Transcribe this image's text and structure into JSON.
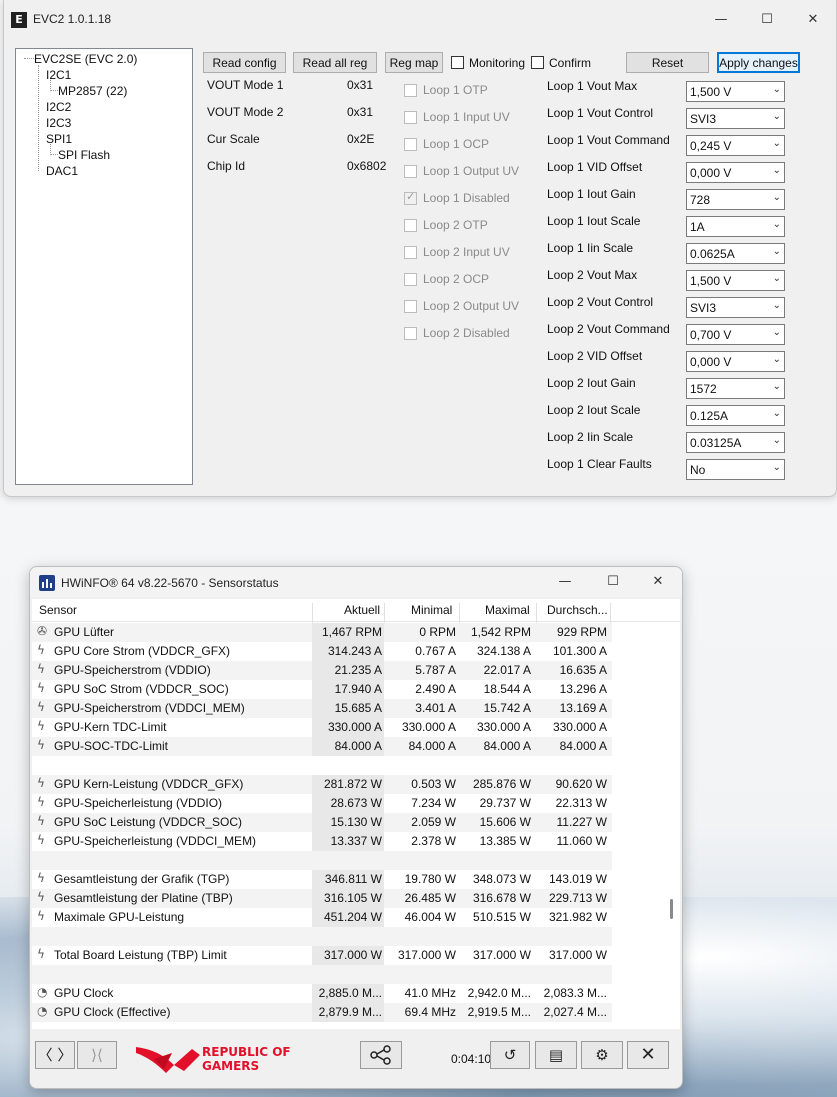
{
  "evc": {
    "title": "EVC2 1.0.1.18",
    "logo_text": "E",
    "controls": {
      "minimize": "—",
      "maximize": "☐",
      "close": "✕"
    },
    "tree": [
      {
        "label": "EVC2SE (EVC 2.0)"
      },
      {
        "label": "I2C1"
      },
      {
        "label": "MP2857 (22)"
      },
      {
        "label": "I2C2"
      },
      {
        "label": "I2C3"
      },
      {
        "label": "SPI1"
      },
      {
        "label": "SPI Flash"
      },
      {
        "label": "DAC1"
      }
    ],
    "buttons": {
      "read_config": "Read config",
      "read_all_reg": "Read all reg",
      "reg_map": "Reg map",
      "reset": "Reset",
      "apply": "Apply changes"
    },
    "toggles": {
      "monitoring": "Monitoring",
      "confirm": "Confirm"
    },
    "info": [
      {
        "label": "VOUT Mode 1",
        "value": "0x31"
      },
      {
        "label": "VOUT Mode 2",
        "value": "0x31"
      },
      {
        "label": "Cur Scale",
        "value": "0x2E"
      },
      {
        "label": "Chip Id",
        "value": "0x6802"
      }
    ],
    "flags": [
      {
        "label": "Loop 1 OTP",
        "checked": false
      },
      {
        "label": "Loop 1 Input UV",
        "checked": false
      },
      {
        "label": "Loop 1 OCP",
        "checked": false
      },
      {
        "label": "Loop 1 Output UV",
        "checked": false
      },
      {
        "label": "Loop 1 Disabled",
        "checked": true
      },
      {
        "label": "Loop 2 OTP",
        "checked": false
      },
      {
        "label": "Loop 2 Input UV",
        "checked": false
      },
      {
        "label": "Loop 2 OCP",
        "checked": false
      },
      {
        "label": "Loop 2 Output UV",
        "checked": false
      },
      {
        "label": "Loop 2 Disabled",
        "checked": false
      }
    ],
    "settings": [
      {
        "label": "Loop 1 Vout Max",
        "value": "1,500 V"
      },
      {
        "label": "Loop 1 Vout Control",
        "value": "SVI3"
      },
      {
        "label": "Loop 1 Vout Command",
        "value": "0,245 V"
      },
      {
        "label": "Loop 1 VID Offset",
        "value": "0,000 V"
      },
      {
        "label": "Loop 1 Iout Gain",
        "value": "728"
      },
      {
        "label": "Loop 1 Iout Scale",
        "value": "1A"
      },
      {
        "label": "Loop 1 Iin Scale",
        "value": "0.0625A"
      },
      {
        "label": "Loop 2 Vout Max",
        "value": "1,500 V"
      },
      {
        "label": "Loop 2 Vout Control",
        "value": "SVI3"
      },
      {
        "label": "Loop 2 Vout Command",
        "value": "0,700 V"
      },
      {
        "label": "Loop 2 VID Offset",
        "value": "0,000 V"
      },
      {
        "label": "Loop 2 Iout Gain",
        "value": "1572"
      },
      {
        "label": "Loop 2 Iout Scale",
        "value": "0.125A"
      },
      {
        "label": "Loop 2 Iin Scale",
        "value": "0.03125A"
      },
      {
        "label": "Loop 1 Clear Faults",
        "value": "No"
      }
    ]
  },
  "hw": {
    "title": "HWiNFO® 64 v8.22-5670 - Sensorstatus",
    "controls": {
      "minimize": "—",
      "maximize": "☐",
      "close": "✕"
    },
    "columns": [
      "Sensor",
      "Aktuell",
      "Minimal",
      "Maximal",
      "Durchsch..."
    ],
    "rows": [
      {
        "icon": "fan-icon",
        "name": "GPU Lüfter",
        "cur": "1,467 RPM",
        "min": "0 RPM",
        "max": "1,542 RPM",
        "avg": "929 RPM"
      },
      {
        "icon": "lightning-icon",
        "name": "GPU Core Strom (VDDCR_GFX)",
        "cur": "314.243 A",
        "min": "0.767 A",
        "max": "324.138 A",
        "avg": "101.300 A"
      },
      {
        "icon": "lightning-icon",
        "name": "GPU-Speicherstrom (VDDIO)",
        "cur": "21.235 A",
        "min": "5.787 A",
        "max": "22.017 A",
        "avg": "16.635 A"
      },
      {
        "icon": "lightning-icon",
        "name": "GPU SoC Strom (VDDCR_SOC)",
        "cur": "17.940 A",
        "min": "2.490 A",
        "max": "18.544 A",
        "avg": "13.296 A"
      },
      {
        "icon": "lightning-icon",
        "name": "GPU-Speicherstrom (VDDCI_MEM)",
        "cur": "15.685 A",
        "min": "3.401 A",
        "max": "15.742 A",
        "avg": "13.169 A"
      },
      {
        "icon": "lightning-icon",
        "name": "GPU-Kern TDC-Limit",
        "cur": "330.000 A",
        "min": "330.000 A",
        "max": "330.000 A",
        "avg": "330.000 A"
      },
      {
        "icon": "lightning-icon",
        "name": "GPU-SOC-TDC-Limit",
        "cur": "84.000 A",
        "min": "84.000 A",
        "max": "84.000 A",
        "avg": "84.000 A"
      },
      {
        "blank": true
      },
      {
        "icon": "lightning-icon",
        "name": "GPU Kern-Leistung (VDDCR_GFX)",
        "cur": "281.872 W",
        "min": "0.503 W",
        "max": "285.876 W",
        "avg": "90.620 W"
      },
      {
        "icon": "lightning-icon",
        "name": "GPU-Speicherleistung (VDDIO)",
        "cur": "28.673 W",
        "min": "7.234 W",
        "max": "29.737 W",
        "avg": "22.313 W"
      },
      {
        "icon": "lightning-icon",
        "name": "GPU SoC Leistung (VDDCR_SOC)",
        "cur": "15.130 W",
        "min": "2.059 W",
        "max": "15.606 W",
        "avg": "11.227 W"
      },
      {
        "icon": "lightning-icon",
        "name": "GPU-Speicherleistung (VDDCI_MEM)",
        "cur": "13.337 W",
        "min": "2.378 W",
        "max": "13.385 W",
        "avg": "11.060 W"
      },
      {
        "blank": true
      },
      {
        "icon": "lightning-icon",
        "name": "Gesamtleistung der Grafik (TGP)",
        "cur": "346.811 W",
        "min": "19.780 W",
        "max": "348.073 W",
        "avg": "143.019 W"
      },
      {
        "icon": "lightning-icon",
        "name": "Gesamtleistung der Platine (TBP)",
        "cur": "316.105 W",
        "min": "26.485 W",
        "max": "316.678 W",
        "avg": "229.713 W"
      },
      {
        "icon": "lightning-icon",
        "name": "Maximale GPU-Leistung",
        "cur": "451.204 W",
        "min": "46.004 W",
        "max": "510.515 W",
        "avg": "321.982 W"
      },
      {
        "blank": true
      },
      {
        "icon": "lightning-icon",
        "name": "Total Board Leistung (TBP) Limit",
        "cur": "317.000 W",
        "min": "317.000 W",
        "max": "317.000 W",
        "avg": "317.000 W"
      },
      {
        "blank": true
      },
      {
        "icon": "clock-icon",
        "name": "GPU Clock",
        "cur": "2,885.0 M...",
        "min": "41.0 MHz",
        "max": "2,942.0 M...",
        "avg": "2,083.3 M..."
      },
      {
        "icon": "clock-icon",
        "name": "GPU Clock (Effective)",
        "cur": "2,879.9 M...",
        "min": "69.4 MHz",
        "max": "2,919.5 M...",
        "avg": "2,027.4 M..."
      }
    ],
    "footer": {
      "rog_line1": "REPUBLIC OF",
      "rog_line2": "GAMERS",
      "timer": "0:04:10",
      "rog_color": "#e3102a"
    }
  }
}
